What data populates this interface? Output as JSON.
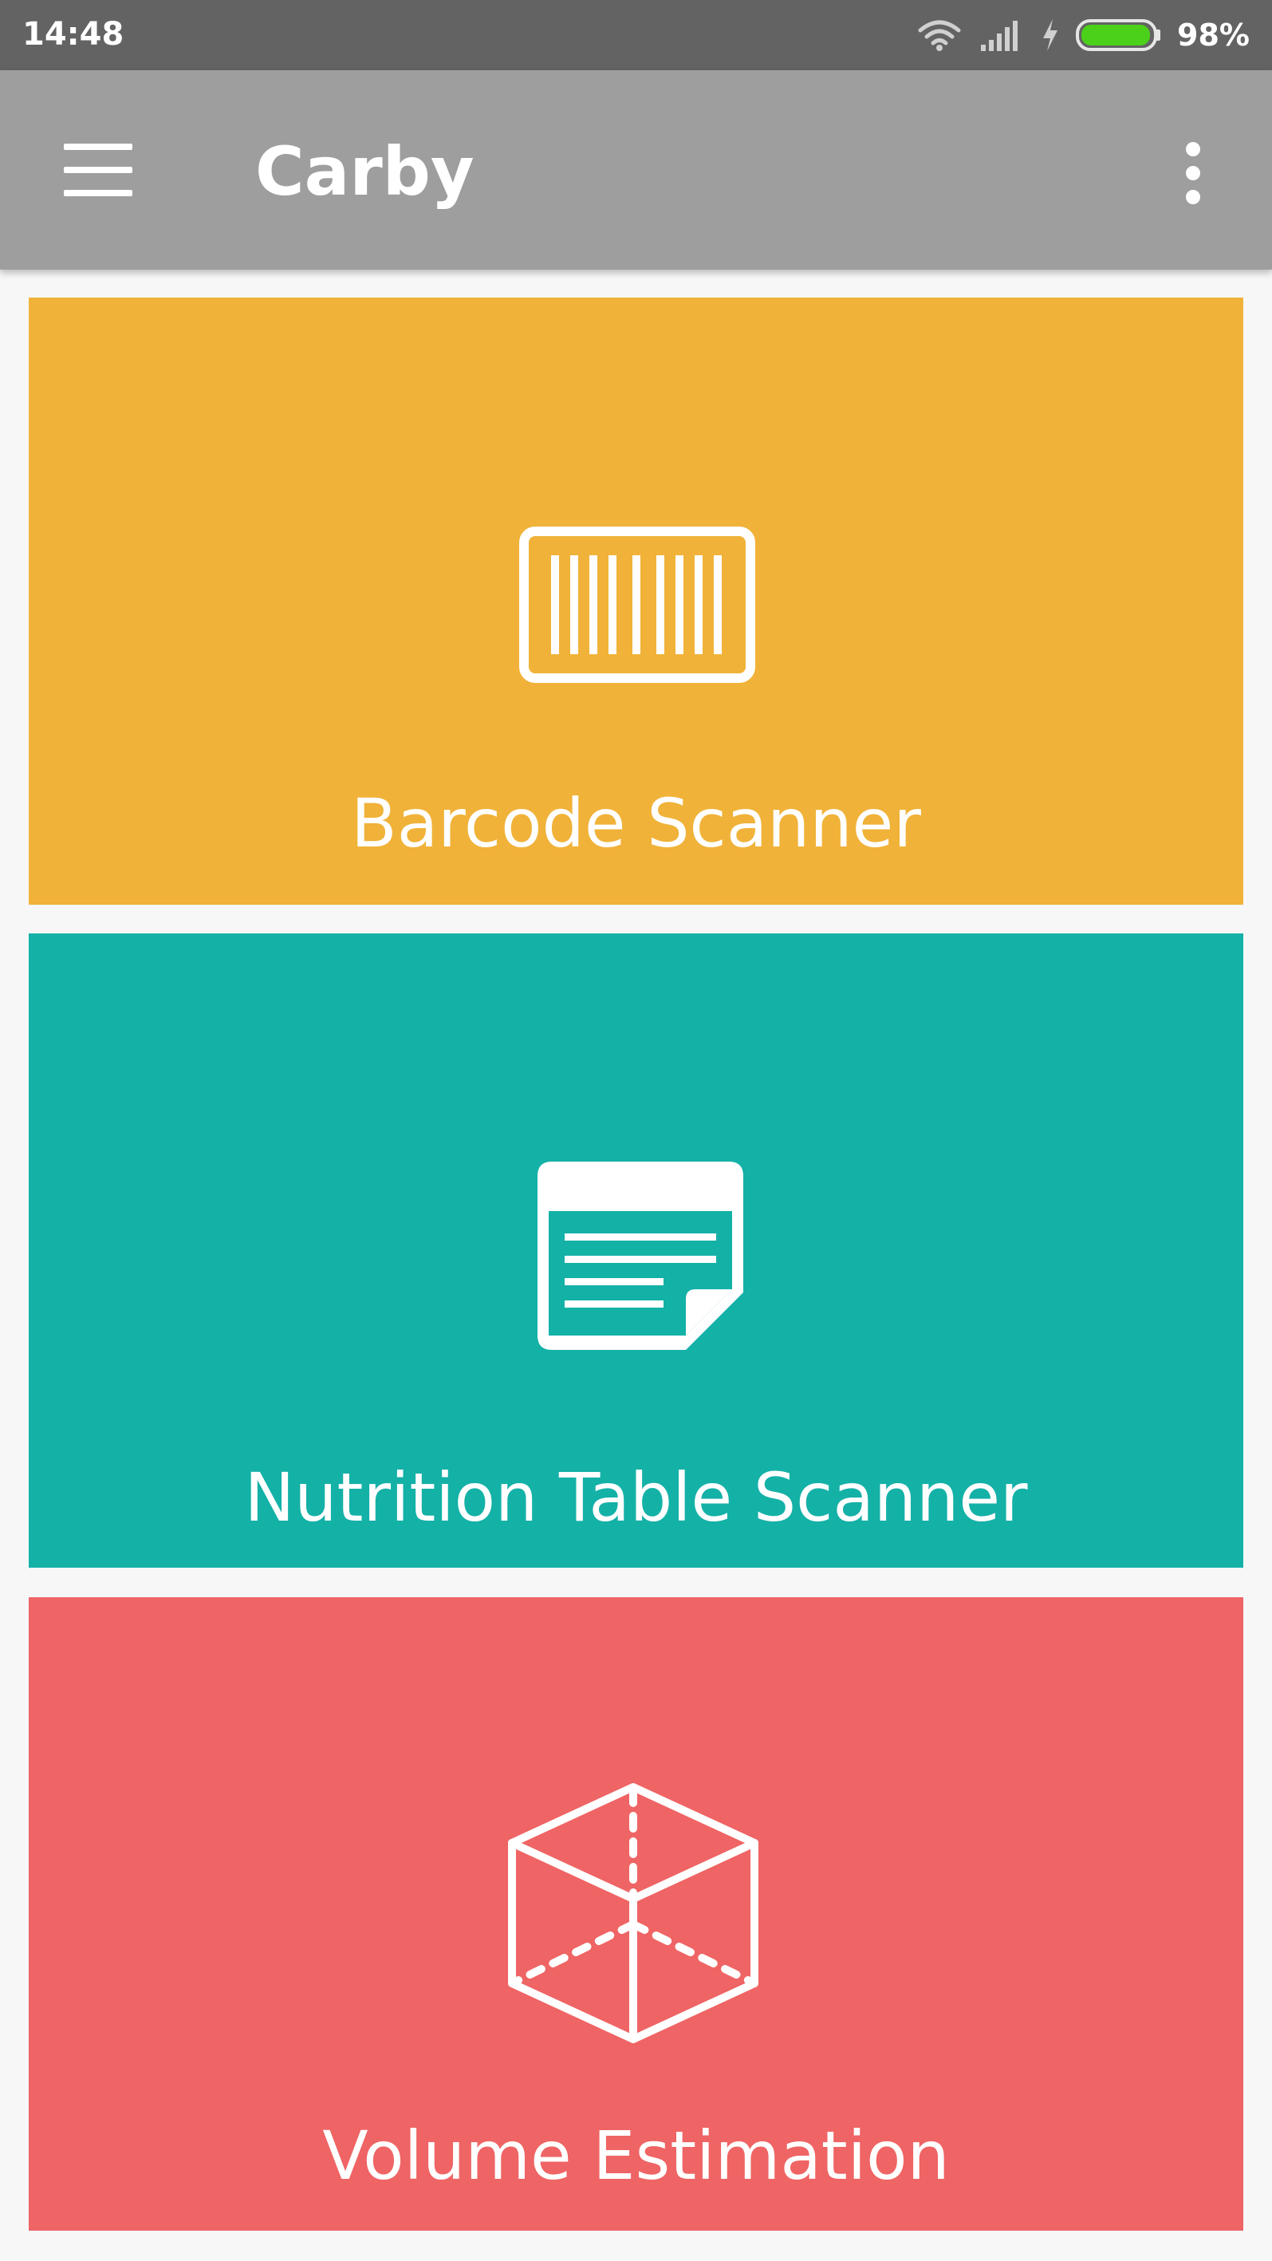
{
  "status_bar": {
    "time": "14:48",
    "battery_percent": "98%",
    "icons": [
      "wifi-icon",
      "signal-icon",
      "charging-icon",
      "battery-icon"
    ]
  },
  "app_bar": {
    "title": "Carby",
    "menu_icon": "hamburger-menu-icon",
    "overflow_icon": "more-vert-icon",
    "color": "#9e9e9e"
  },
  "cards": [
    {
      "label": "Barcode Scanner",
      "icon": "barcode-icon",
      "color": "#f0b238"
    },
    {
      "label": "Nutrition Table Scanner",
      "icon": "document-icon",
      "color": "#14b1a7"
    },
    {
      "label": "Volume Estimation",
      "icon": "cube-icon",
      "color": "#ef6464"
    }
  ]
}
